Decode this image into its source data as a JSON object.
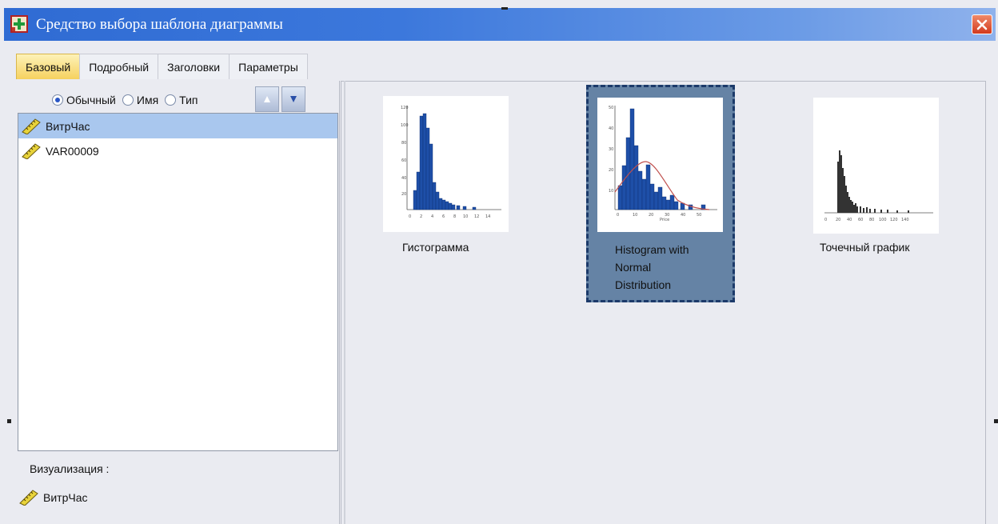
{
  "window": {
    "title": "Средство выбора шаблона диаграммы"
  },
  "tabs": [
    {
      "label": "Базовый",
      "active": true
    },
    {
      "label": "Подробный",
      "active": false
    },
    {
      "label": "Заголовки",
      "active": false
    },
    {
      "label": "Параметры",
      "active": false
    }
  ],
  "sort": {
    "options": [
      "Обычный",
      "Имя",
      "Тип"
    ],
    "selected": "Обычный"
  },
  "variables": [
    {
      "name": "ВитрЧас",
      "selected": true,
      "icon": "ruler-icon"
    },
    {
      "name": "VAR00009",
      "selected": false,
      "icon": "ruler-icon"
    }
  ],
  "visualization": {
    "label": "Визуализация :",
    "variable": "ВитрЧас"
  },
  "gallery": [
    {
      "label_lines": [
        "Гистограмма"
      ],
      "selected": false
    },
    {
      "label_lines": [
        "Histogram with",
        "Normal",
        "Distribution"
      ],
      "selected": true
    },
    {
      "label_lines": [
        "Точечный график"
      ],
      "selected": false
    }
  ],
  "colors": {
    "titlebar": "#3c78dc",
    "active_tab": "#f6d15f",
    "selection": "#a9c7ee",
    "selected_tile": "#6583a5",
    "bars": "#1e4fa8"
  }
}
